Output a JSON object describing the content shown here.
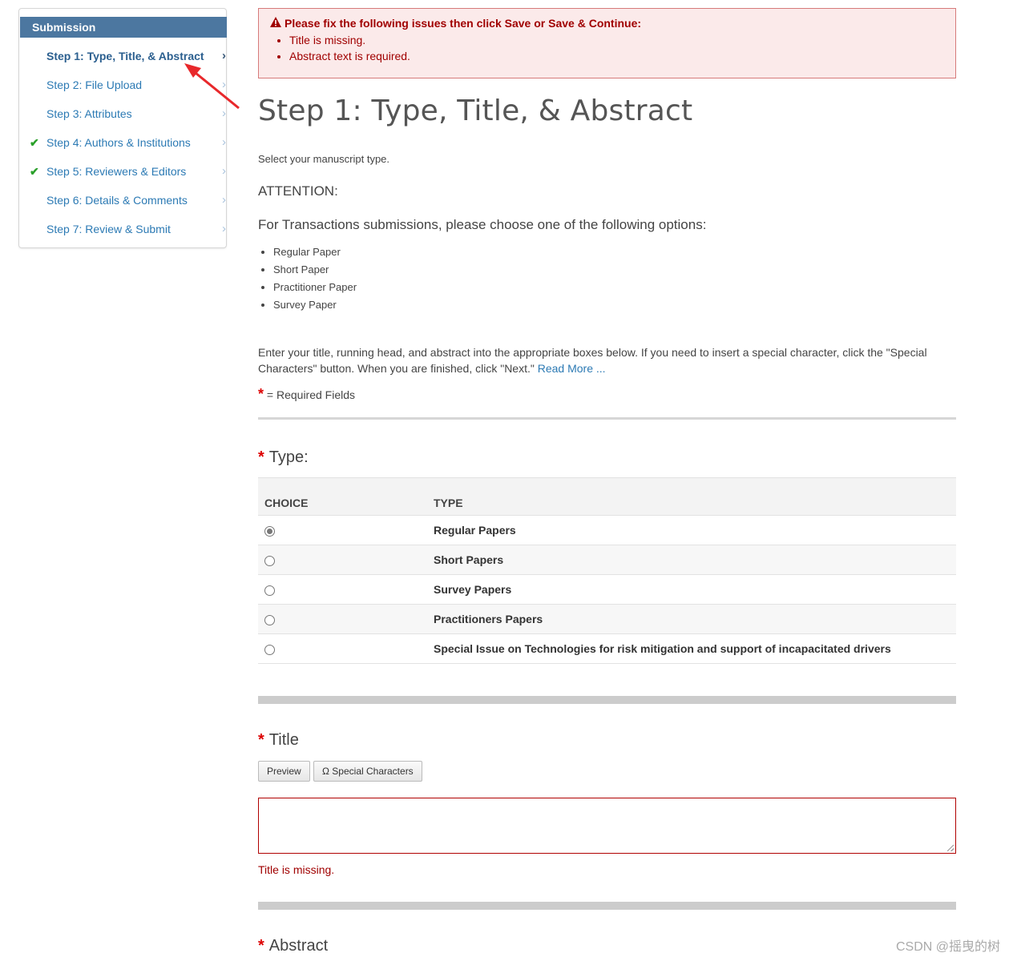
{
  "sidebar": {
    "header": "Submission",
    "items": [
      {
        "label": "Step 1: Type, Title, & Abstract",
        "active": true,
        "checked": false
      },
      {
        "label": "Step 2: File Upload",
        "active": false,
        "checked": false
      },
      {
        "label": "Step 3: Attributes",
        "active": false,
        "checked": false
      },
      {
        "label": "Step 4: Authors & Institutions",
        "active": false,
        "checked": true
      },
      {
        "label": "Step 5: Reviewers & Editors",
        "active": false,
        "checked": true
      },
      {
        "label": "Step 6: Details & Comments",
        "active": false,
        "checked": false
      },
      {
        "label": "Step 7: Review & Submit",
        "active": false,
        "checked": false
      }
    ],
    "chevron": "›",
    "check": "✔"
  },
  "error": {
    "title": "Please fix the following issues then click Save or Save & Continue:",
    "items": [
      "Title is missing.",
      "Abstract text is required."
    ]
  },
  "page": {
    "title": "Step 1: Type, Title, & Abstract",
    "select_type": "Select your manuscript type.",
    "attention": "ATTENTION:",
    "transactions": "For Transactions submissions, please choose one of the following options:",
    "options": [
      "Regular Paper",
      "Short Paper",
      "Practitioner Paper",
      "Survey Paper"
    ],
    "instructions": "Enter your title, running head, and abstract into the appropriate boxes below. If you need to insert a special character, click the \"Special Characters\" button. When you are finished, click \"Next.\" ",
    "read_more": "Read More ...",
    "required_star": "*",
    "required_text": " = Required Fields"
  },
  "type_section": {
    "label": "Type:",
    "columns": [
      "CHOICE",
      "TYPE"
    ],
    "rows": [
      {
        "type": "Regular Papers",
        "selected": true
      },
      {
        "type": "Short Papers",
        "selected": false
      },
      {
        "type": "Survey Papers",
        "selected": false
      },
      {
        "type": "Practitioners Papers",
        "selected": false
      },
      {
        "type": "Special Issue on Technologies for risk mitigation and support of incapacitated drivers",
        "selected": false
      }
    ]
  },
  "title_section": {
    "label": "Title",
    "preview_button": "Preview",
    "special_chars_button": "Ω Special Characters",
    "value": "",
    "error": "Title is missing."
  },
  "abstract_section": {
    "label": "Abstract"
  },
  "watermark": "CSDN @摇曳的树",
  "colors": {
    "accent": "#4c77a0",
    "link": "#2c7ab4",
    "error": "#a00000",
    "error_bg": "#fbeaea",
    "check": "#2aa02a",
    "annotation_arrow": "#e8282b"
  }
}
